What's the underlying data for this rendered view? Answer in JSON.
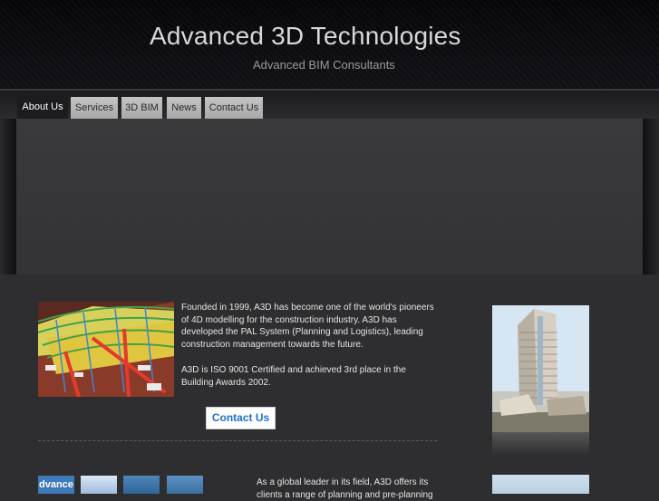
{
  "header": {
    "title": "Advanced 3D Technologies",
    "subtitle": "Advanced BIM Consultants"
  },
  "nav": {
    "items": [
      {
        "label": "About Us",
        "active": true
      },
      {
        "label": "Services",
        "active": false
      },
      {
        "label": "3D BIM",
        "active": false
      },
      {
        "label": "News",
        "active": false
      },
      {
        "label": "Contact Us",
        "active": false
      }
    ]
  },
  "intro": {
    "paragraph1": "Founded in 1999, A3D has become one of the world's pioneers of 4D modelling for the construction industry. A3D has developed the PAL System (Planning and Logistics), leading construction management towards the future.",
    "paragraph2": "A3D is ISO 9001 Certified and achieved 3rd place in the Building Awards 2002.",
    "contact_button": "Contact Us"
  },
  "lower": {
    "thumb_label": "dvance",
    "paragraph": "As a global leader in its field, A3D offers its clients a range of planning and pre-planning"
  },
  "colors": {
    "page_bg": "#2e2e30",
    "header_bg": "#0b0b0f",
    "nav_active_bg": "#1c1c1e",
    "nav_inactive_bg": "#b8b8b8",
    "link_blue": "#1e6fcf"
  }
}
